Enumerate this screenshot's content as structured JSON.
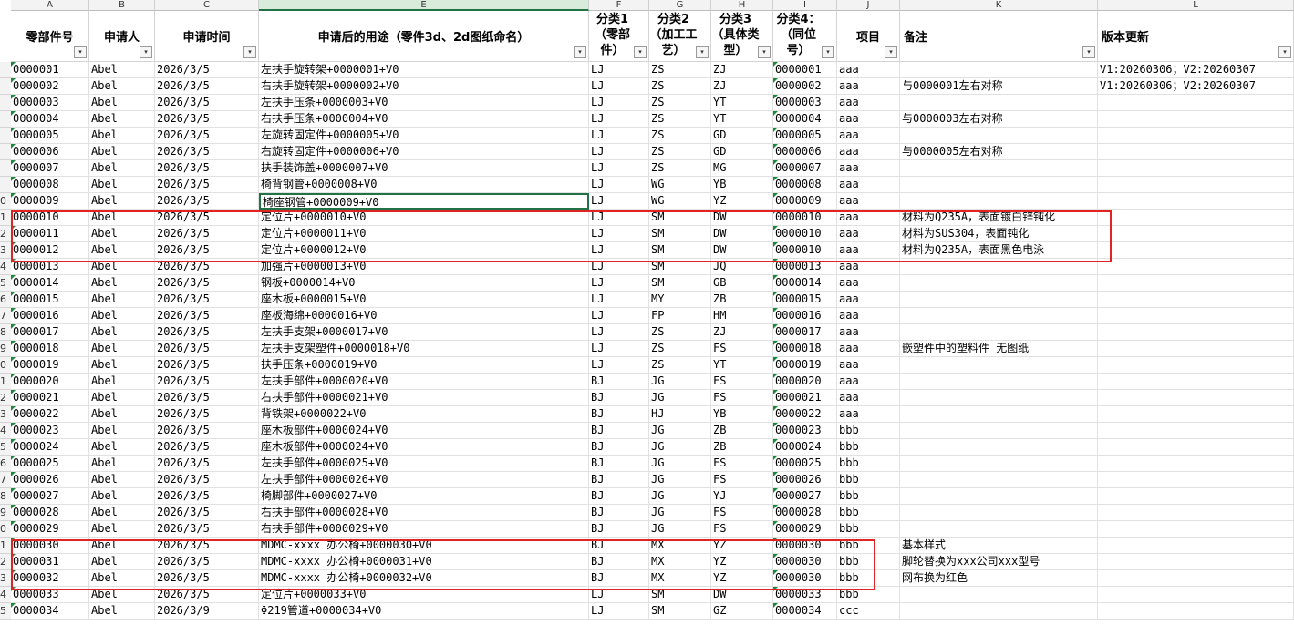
{
  "column_letters": [
    "A",
    "B",
    "C",
    "E",
    "F",
    "G",
    "H",
    "I",
    "J",
    "K",
    "L"
  ],
  "headers": [
    {
      "label": "零部件号",
      "filter": "▾"
    },
    {
      "label": "申请人",
      "filter": "▾"
    },
    {
      "label": "申请时间",
      "filter": "▾"
    },
    {
      "label": "申请后的用途（零件3d、2d图纸命名）",
      "filter": "▾"
    },
    {
      "label": "分类1（零部件）",
      "filter": "▾"
    },
    {
      "label": "分类2（加工工艺）",
      "filter": "▾"
    },
    {
      "label": "分类3（具体类型）",
      "filter": "▾"
    },
    {
      "label": "分类4：（同位号）",
      "filter": "▾"
    },
    {
      "label": "项目",
      "filter": "▾"
    },
    {
      "label": "备注",
      "filter": "▾"
    },
    {
      "label": "版本更新",
      "filter": "▾"
    }
  ],
  "row_numbers": [
    "",
    "",
    "",
    "",
    "",
    "",
    "",
    "",
    "0",
    "1",
    "2",
    "3",
    "4",
    "5",
    "6",
    "7",
    "8",
    "9",
    "0",
    "1",
    "2",
    "3",
    "4",
    "5",
    "6",
    "7",
    "8",
    "9",
    "0",
    "1",
    "2",
    "3",
    "4",
    "5"
  ],
  "rows": [
    [
      "0000001",
      "Abel",
      "2026/3/5",
      "左扶手旋转架+0000001+V0",
      "LJ",
      "ZS",
      "ZJ",
      "0000001",
      "aaa",
      "",
      "V1:20260306；V2:20260307"
    ],
    [
      "0000002",
      "Abel",
      "2026/3/5",
      "右扶手旋转架+0000002+V0",
      "LJ",
      "ZS",
      "ZJ",
      "0000002",
      "aaa",
      "与0000001左右对称",
      "V1:20260306；V2:20260307"
    ],
    [
      "0000003",
      "Abel",
      "2026/3/5",
      "左扶手压条+0000003+V0",
      "LJ",
      "ZS",
      "YT",
      "0000003",
      "aaa",
      "",
      ""
    ],
    [
      "0000004",
      "Abel",
      "2026/3/5",
      "右扶手压条+0000004+V0",
      "LJ",
      "ZS",
      "YT",
      "0000004",
      "aaa",
      "与0000003左右对称",
      ""
    ],
    [
      "0000005",
      "Abel",
      "2026/3/5",
      "左旋转固定件+0000005+V0",
      "LJ",
      "ZS",
      "GD",
      "0000005",
      "aaa",
      "",
      ""
    ],
    [
      "0000006",
      "Abel",
      "2026/3/5",
      "右旋转固定件+0000006+V0",
      "LJ",
      "ZS",
      "GD",
      "0000006",
      "aaa",
      "与0000005左右对称",
      ""
    ],
    [
      "0000007",
      "Abel",
      "2026/3/5",
      "扶手装饰盖+0000007+V0",
      "LJ",
      "ZS",
      "MG",
      "0000007",
      "aaa",
      "",
      ""
    ],
    [
      "0000008",
      "Abel",
      "2026/3/5",
      "椅背钢管+0000008+V0",
      "LJ",
      "WG",
      "YB",
      "0000008",
      "aaa",
      "",
      ""
    ],
    [
      "0000009",
      "Abel",
      "2026/3/5",
      "椅座钢管+0000009+V0",
      "LJ",
      "WG",
      "YZ",
      "0000009",
      "aaa",
      "",
      ""
    ],
    [
      "0000010",
      "Abel",
      "2026/3/5",
      "定位片+0000010+V0",
      "LJ",
      "SM",
      "DW",
      "0000010",
      "aaa",
      "材料为Q235A，表面镀白锌钝化",
      ""
    ],
    [
      "0000011",
      "Abel",
      "2026/3/5",
      "定位片+0000011+V0",
      "LJ",
      "SM",
      "DW",
      "0000010",
      "aaa",
      "材料为SUS304，表面钝化",
      ""
    ],
    [
      "0000012",
      "Abel",
      "2026/3/5",
      "定位片+0000012+V0",
      "LJ",
      "SM",
      "DW",
      "0000010",
      "aaa",
      "材料为Q235A，表面黑色电泳",
      ""
    ],
    [
      "0000013",
      "Abel",
      "2026/3/5",
      "加强片+0000013+V0",
      "LJ",
      "SM",
      "JQ",
      "0000013",
      "aaa",
      "",
      ""
    ],
    [
      "0000014",
      "Abel",
      "2026/3/5",
      "钢板+0000014+V0",
      "LJ",
      "SM",
      "GB",
      "0000014",
      "aaa",
      "",
      ""
    ],
    [
      "0000015",
      "Abel",
      "2026/3/5",
      "座木板+0000015+V0",
      "LJ",
      "MY",
      "ZB",
      "0000015",
      "aaa",
      "",
      ""
    ],
    [
      "0000016",
      "Abel",
      "2026/3/5",
      "座板海绵+0000016+V0",
      "LJ",
      "FP",
      "HM",
      "0000016",
      "aaa",
      "",
      ""
    ],
    [
      "0000017",
      "Abel",
      "2026/3/5",
      "左扶手支架+0000017+V0",
      "LJ",
      "ZS",
      "ZJ",
      "0000017",
      "aaa",
      "",
      ""
    ],
    [
      "0000018",
      "Abel",
      "2026/3/5",
      "左扶手支架塑件+0000018+V0",
      "LJ",
      "ZS",
      "FS",
      "0000018",
      "aaa",
      "嵌塑件中的塑料件 无图纸",
      ""
    ],
    [
      "0000019",
      "Abel",
      "2026/3/5",
      "扶手压条+0000019+V0",
      "LJ",
      "ZS",
      "YT",
      "0000019",
      "aaa",
      "",
      ""
    ],
    [
      "0000020",
      "Abel",
      "2026/3/5",
      "左扶手部件+0000020+V0",
      "BJ",
      "JG",
      "FS",
      "0000020",
      "aaa",
      "",
      ""
    ],
    [
      "0000021",
      "Abel",
      "2026/3/5",
      "右扶手部件+0000021+V0",
      "BJ",
      "JG",
      "FS",
      "0000021",
      "aaa",
      "",
      ""
    ],
    [
      "0000022",
      "Abel",
      "2026/3/5",
      "背铁架+0000022+V0",
      "BJ",
      "HJ",
      "YB",
      "0000022",
      "aaa",
      "",
      ""
    ],
    [
      "0000023",
      "Abel",
      "2026/3/5",
      "座木板部件+0000024+V0",
      "BJ",
      "JG",
      "ZB",
      "0000023",
      "bbb",
      "",
      ""
    ],
    [
      "0000024",
      "Abel",
      "2026/3/5",
      "座木板部件+0000024+V0",
      "BJ",
      "JG",
      "ZB",
      "0000024",
      "bbb",
      "",
      ""
    ],
    [
      "0000025",
      "Abel",
      "2026/3/5",
      "左扶手部件+0000025+V0",
      "BJ",
      "JG",
      "FS",
      "0000025",
      "bbb",
      "",
      ""
    ],
    [
      "0000026",
      "Abel",
      "2026/3/5",
      "左扶手部件+0000026+V0",
      "BJ",
      "JG",
      "FS",
      "0000026",
      "bbb",
      "",
      ""
    ],
    [
      "0000027",
      "Abel",
      "2026/3/5",
      "椅脚部件+0000027+V0",
      "BJ",
      "JG",
      "YJ",
      "0000027",
      "bbb",
      "",
      ""
    ],
    [
      "0000028",
      "Abel",
      "2026/3/5",
      "右扶手部件+0000028+V0",
      "BJ",
      "JG",
      "FS",
      "0000028",
      "bbb",
      "",
      ""
    ],
    [
      "0000029",
      "Abel",
      "2026/3/5",
      "右扶手部件+0000029+V0",
      "BJ",
      "JG",
      "FS",
      "0000029",
      "bbb",
      "",
      ""
    ],
    [
      "0000030",
      "Abel",
      "2026/3/5",
      "MDMC-xxxx 办公椅+0000030+V0",
      "BJ",
      "MX",
      "YZ",
      "0000030",
      "bbb",
      "基本样式",
      ""
    ],
    [
      "0000031",
      "Abel",
      "2026/3/5",
      "MDMC-xxxx 办公椅+0000031+V0",
      "BJ",
      "MX",
      "YZ",
      "0000030",
      "bbb",
      "脚轮替换为xxx公司xxx型号",
      ""
    ],
    [
      "0000032",
      "Abel",
      "2026/3/5",
      "MDMC-xxxx 办公椅+0000032+V0",
      "BJ",
      "MX",
      "YZ",
      "0000030",
      "bbb",
      "网布换为红色",
      ""
    ],
    [
      "0000033",
      "Abel",
      "2026/3/5",
      "定位片+0000033+V0",
      "LJ",
      "SM",
      "DW",
      "0000033",
      "bbb",
      "",
      ""
    ],
    [
      "0000034",
      "Abel",
      "2026/3/9",
      "Φ219管道+0000034+V0",
      "LJ",
      "SM",
      "GZ",
      "0000034",
      "ccc",
      "",
      ""
    ]
  ],
  "colors": {
    "header_bg": "#f3f3f3",
    "active_border": "#217346",
    "highlight_border": "#e02424",
    "comment_marker": "#1a8a3a"
  }
}
